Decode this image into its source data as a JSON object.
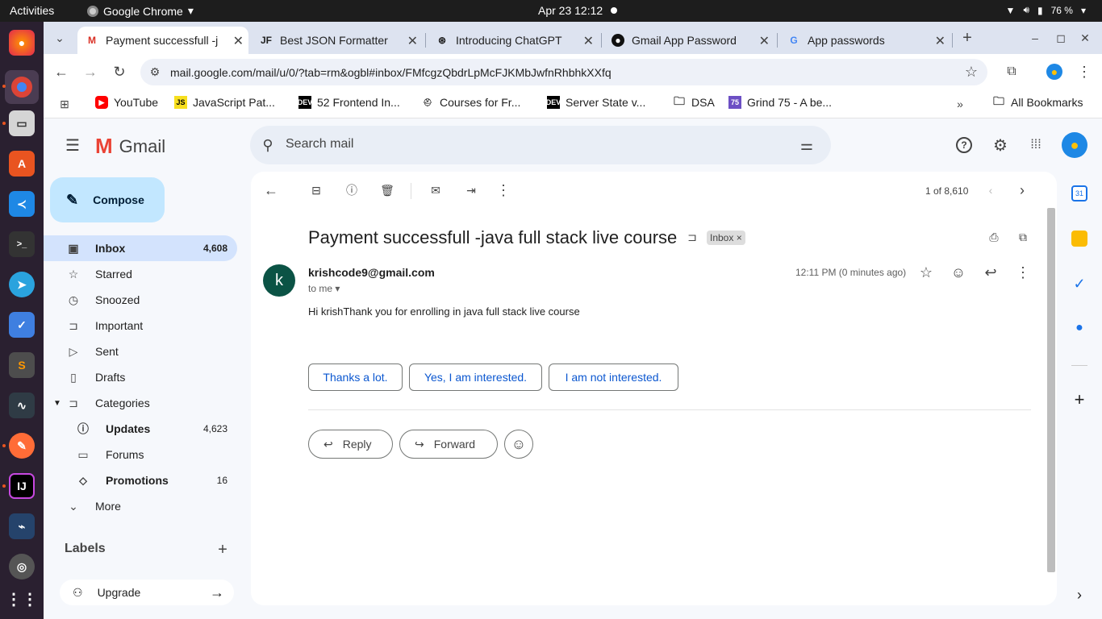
{
  "os": {
    "activities": "Activities",
    "app": "Google Chrome",
    "datetime": "Apr 23  12:12",
    "battery": "76 %"
  },
  "tabs": [
    {
      "title": "Payment successfull -j"
    },
    {
      "title": "Best JSON Formatter"
    },
    {
      "title": "Introducing ChatGPT"
    },
    {
      "title": "Gmail App Password"
    },
    {
      "title": "App passwords"
    }
  ],
  "url": "mail.google.com/mail/u/0/?tab=rm&ogbl#inbox/FMfcgzQbdrLpMcFJKMbJwfnRhbhkXXfq",
  "bookmarks": [
    {
      "label": "YouTube"
    },
    {
      "label": "JavaScript Pat..."
    },
    {
      "label": "52 Frontend In..."
    },
    {
      "label": "Courses for Fr..."
    },
    {
      "label": "Server State v..."
    },
    {
      "label": "DSA"
    },
    {
      "label": "Grind 75 - A be..."
    }
  ],
  "all_bookmarks": "All Bookmarks",
  "gmail": {
    "logo": "Gmail",
    "search_placeholder": "Search mail",
    "compose": "Compose"
  },
  "nav": [
    {
      "label": "Inbox",
      "count": "4,608"
    },
    {
      "label": "Starred",
      "count": ""
    },
    {
      "label": "Snoozed",
      "count": ""
    },
    {
      "label": "Important",
      "count": ""
    },
    {
      "label": "Sent",
      "count": ""
    },
    {
      "label": "Drafts",
      "count": ""
    },
    {
      "label": "Categories",
      "count": ""
    },
    {
      "label": "Updates",
      "count": "4,623"
    },
    {
      "label": "Forums",
      "count": ""
    },
    {
      "label": "Promotions",
      "count": "16"
    },
    {
      "label": "More",
      "count": ""
    }
  ],
  "labels_heading": "Labels",
  "upgrade": "Upgrade",
  "pager": "1 of 8,610",
  "email": {
    "subject": "Payment successfull -java full stack live course",
    "label": "Inbox",
    "avatar": "k",
    "sender": "krishcode9@gmail.com",
    "to": "to me",
    "time": "12:11 PM (0 minutes ago)",
    "body": "Hi krishThank you for enrolling in java full stack live course"
  },
  "smart_replies": [
    "Thanks a lot.",
    "Yes, I am interested.",
    "I am not interested."
  ],
  "actions": {
    "reply": "Reply",
    "forward": "Forward"
  },
  "calendar_day": "31"
}
